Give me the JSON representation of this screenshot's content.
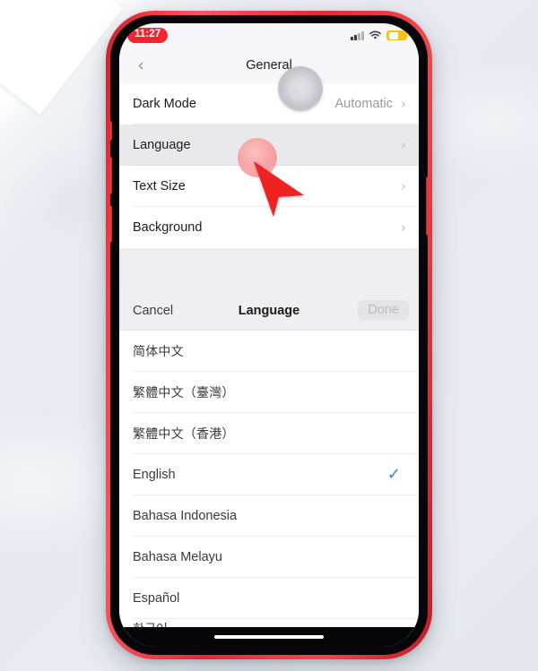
{
  "statusbar": {
    "time": "11:27",
    "recording_indicator": true,
    "signal_icon": "cellular-signal-icon",
    "wifi_icon": "wifi-icon",
    "battery_icon": "battery-low-power-icon",
    "battery_color": "#f6c313"
  },
  "navbar": {
    "back_icon": "chevron-left-icon",
    "title": "General"
  },
  "assistive_touch": {
    "icon": "assistive-touch-icon"
  },
  "settings": {
    "rows": [
      {
        "label": "Dark Mode",
        "value": "Automatic",
        "chevron": "›",
        "pressed": false
      },
      {
        "label": "Language",
        "value": "",
        "chevron": "›",
        "pressed": true
      },
      {
        "label": "Text Size",
        "value": "",
        "chevron": "›",
        "pressed": false
      },
      {
        "label": "Background",
        "value": "",
        "chevron": "›",
        "pressed": false
      }
    ]
  },
  "sheet": {
    "cancel_label": "Cancel",
    "title": "Language",
    "done_label": "Done",
    "done_enabled": false,
    "check_color": "#2f82e8",
    "languages": [
      {
        "label": "简体中文",
        "selected": false,
        "cjk": true
      },
      {
        "label": "繁體中文（臺灣）",
        "selected": false,
        "cjk": true
      },
      {
        "label": "繁體中文（香港）",
        "selected": false,
        "cjk": true
      },
      {
        "label": "English",
        "selected": true,
        "cjk": false
      },
      {
        "label": "Bahasa Indonesia",
        "selected": false,
        "cjk": false
      },
      {
        "label": "Bahasa Melayu",
        "selected": false,
        "cjk": false
      },
      {
        "label": "Español",
        "selected": false,
        "cjk": false
      },
      {
        "label": "한국어",
        "selected": false,
        "cjk": true,
        "partial": true
      }
    ],
    "check_glyph": "✓"
  },
  "cursor": {
    "icon": "mouse-pointer-arrow",
    "color": "#ee2222",
    "tap_highlight": true
  },
  "device": {
    "frame_color": "#e0333b",
    "home_indicator": "home-indicator-bar"
  }
}
